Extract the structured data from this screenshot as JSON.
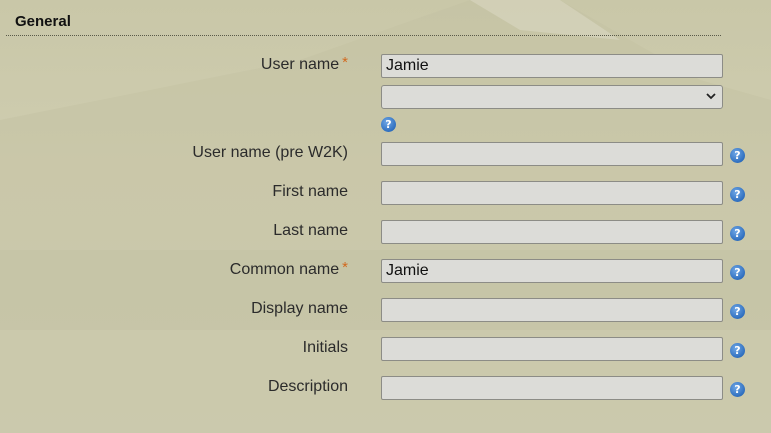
{
  "section": {
    "title": "General"
  },
  "fields": [
    {
      "label": "User name",
      "required": true,
      "value": "Jamie"
    },
    {
      "label": "User name (pre W2K)",
      "required": false,
      "value": ""
    },
    {
      "label": "First name",
      "required": false,
      "value": ""
    },
    {
      "label": "Last name",
      "required": false,
      "value": ""
    },
    {
      "label": "Common name",
      "required": true,
      "value": "Jamie"
    },
    {
      "label": "Display name",
      "required": false,
      "value": ""
    },
    {
      "label": "Initials",
      "required": false,
      "value": ""
    },
    {
      "label": "Description",
      "required": false,
      "value": ""
    }
  ],
  "domain_select": {
    "selected": ""
  },
  "required_marker": "*",
  "help_icon": {
    "icon": "help-icon",
    "glyph": "?"
  },
  "colors": {
    "required": "#d2691e",
    "help": "#2f6fbf",
    "field_bg": "#dcdcd8"
  }
}
